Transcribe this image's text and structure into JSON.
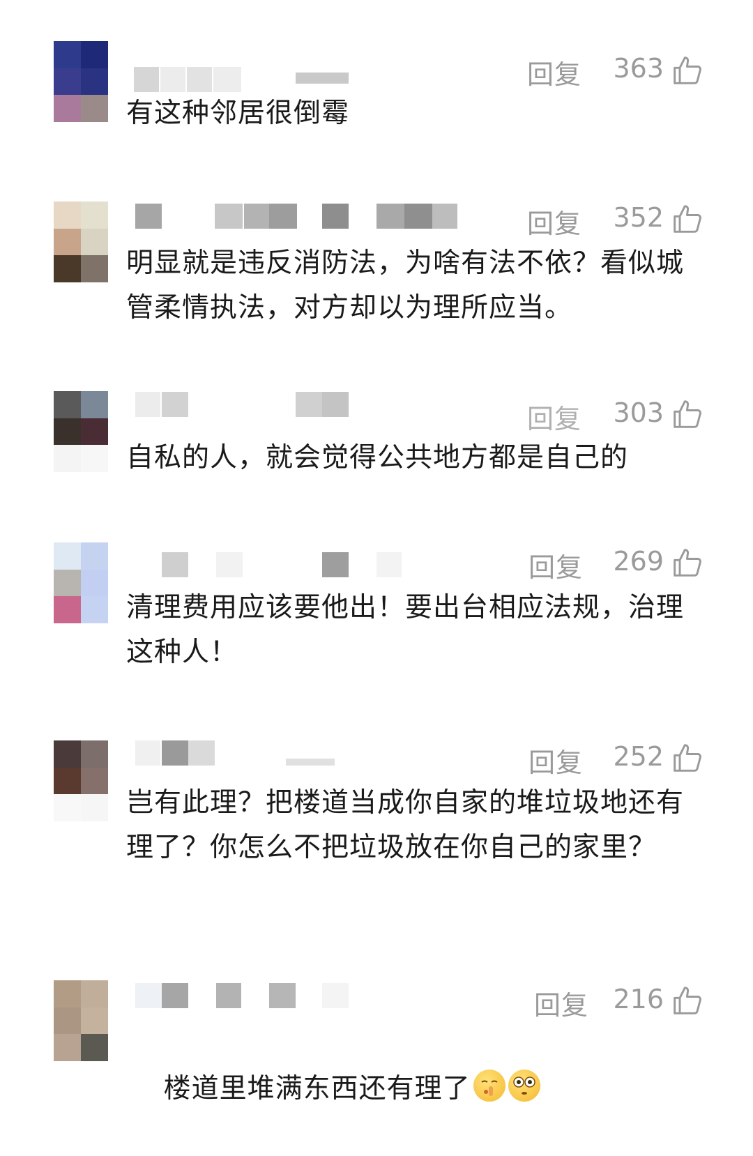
{
  "comments": [
    {
      "reply": "回复",
      "likes": "363",
      "text": "有这种邻居很倒霉"
    },
    {
      "reply": "回复",
      "likes": "352",
      "text": "明显就是违反消防法，为啥有法不依？看似城管柔情执法，对方却以为理所应当。"
    },
    {
      "reply": "回复",
      "likes": "303",
      "text": "自私的人，就会觉得公共地方都是自己的"
    },
    {
      "reply": "回复",
      "likes": "269",
      "text": "清理费用应该要他出！要出台相应法规，治理这种人！"
    },
    {
      "reply": "回复",
      "likes": "252",
      "text": "岂有此理？把楼道当成你自家的堆垃圾地还有理了？你怎么不把垃圾放在你自己的家里？"
    },
    {
      "reply": "回复",
      "likes": "216",
      "text": "楼道里堆满东西还有理了"
    }
  ],
  "icons": {
    "like": "thumbs-up-icon",
    "emoji_1": "shushing-face-emoji",
    "emoji_2": "flushed-face-emoji"
  },
  "colors": {
    "meta_gray": "#9a9a9a",
    "text": "#1a1a1a"
  }
}
